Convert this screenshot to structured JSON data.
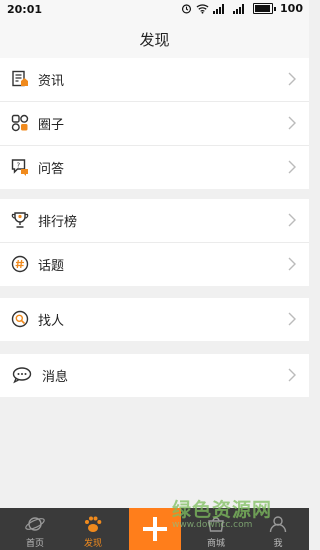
{
  "status": {
    "time": "20:01",
    "battery": "100"
  },
  "title": "发现",
  "groups": [
    {
      "items": [
        {
          "label": "资讯",
          "icon": "news-icon"
        },
        {
          "label": "圈子",
          "icon": "circles-icon"
        },
        {
          "label": "问答",
          "icon": "qa-icon"
        }
      ]
    },
    {
      "items": [
        {
          "label": "排行榜",
          "icon": "trophy-icon"
        },
        {
          "label": "话题",
          "icon": "hashtag-icon"
        }
      ]
    },
    {
      "items": [
        {
          "label": "找人",
          "icon": "find-people-icon"
        }
      ]
    },
    {
      "items": [
        {
          "label": "消息",
          "icon": "message-icon"
        }
      ]
    }
  ],
  "tabs": [
    {
      "label": "首页"
    },
    {
      "label": "发现"
    },
    {
      "label": "商城"
    },
    {
      "label": "我"
    }
  ],
  "accent_color": "#f08a1d",
  "plus_color": "#ff7e1b",
  "watermark": {
    "text": "绿色资源网",
    "url": "www.downcc.com"
  }
}
